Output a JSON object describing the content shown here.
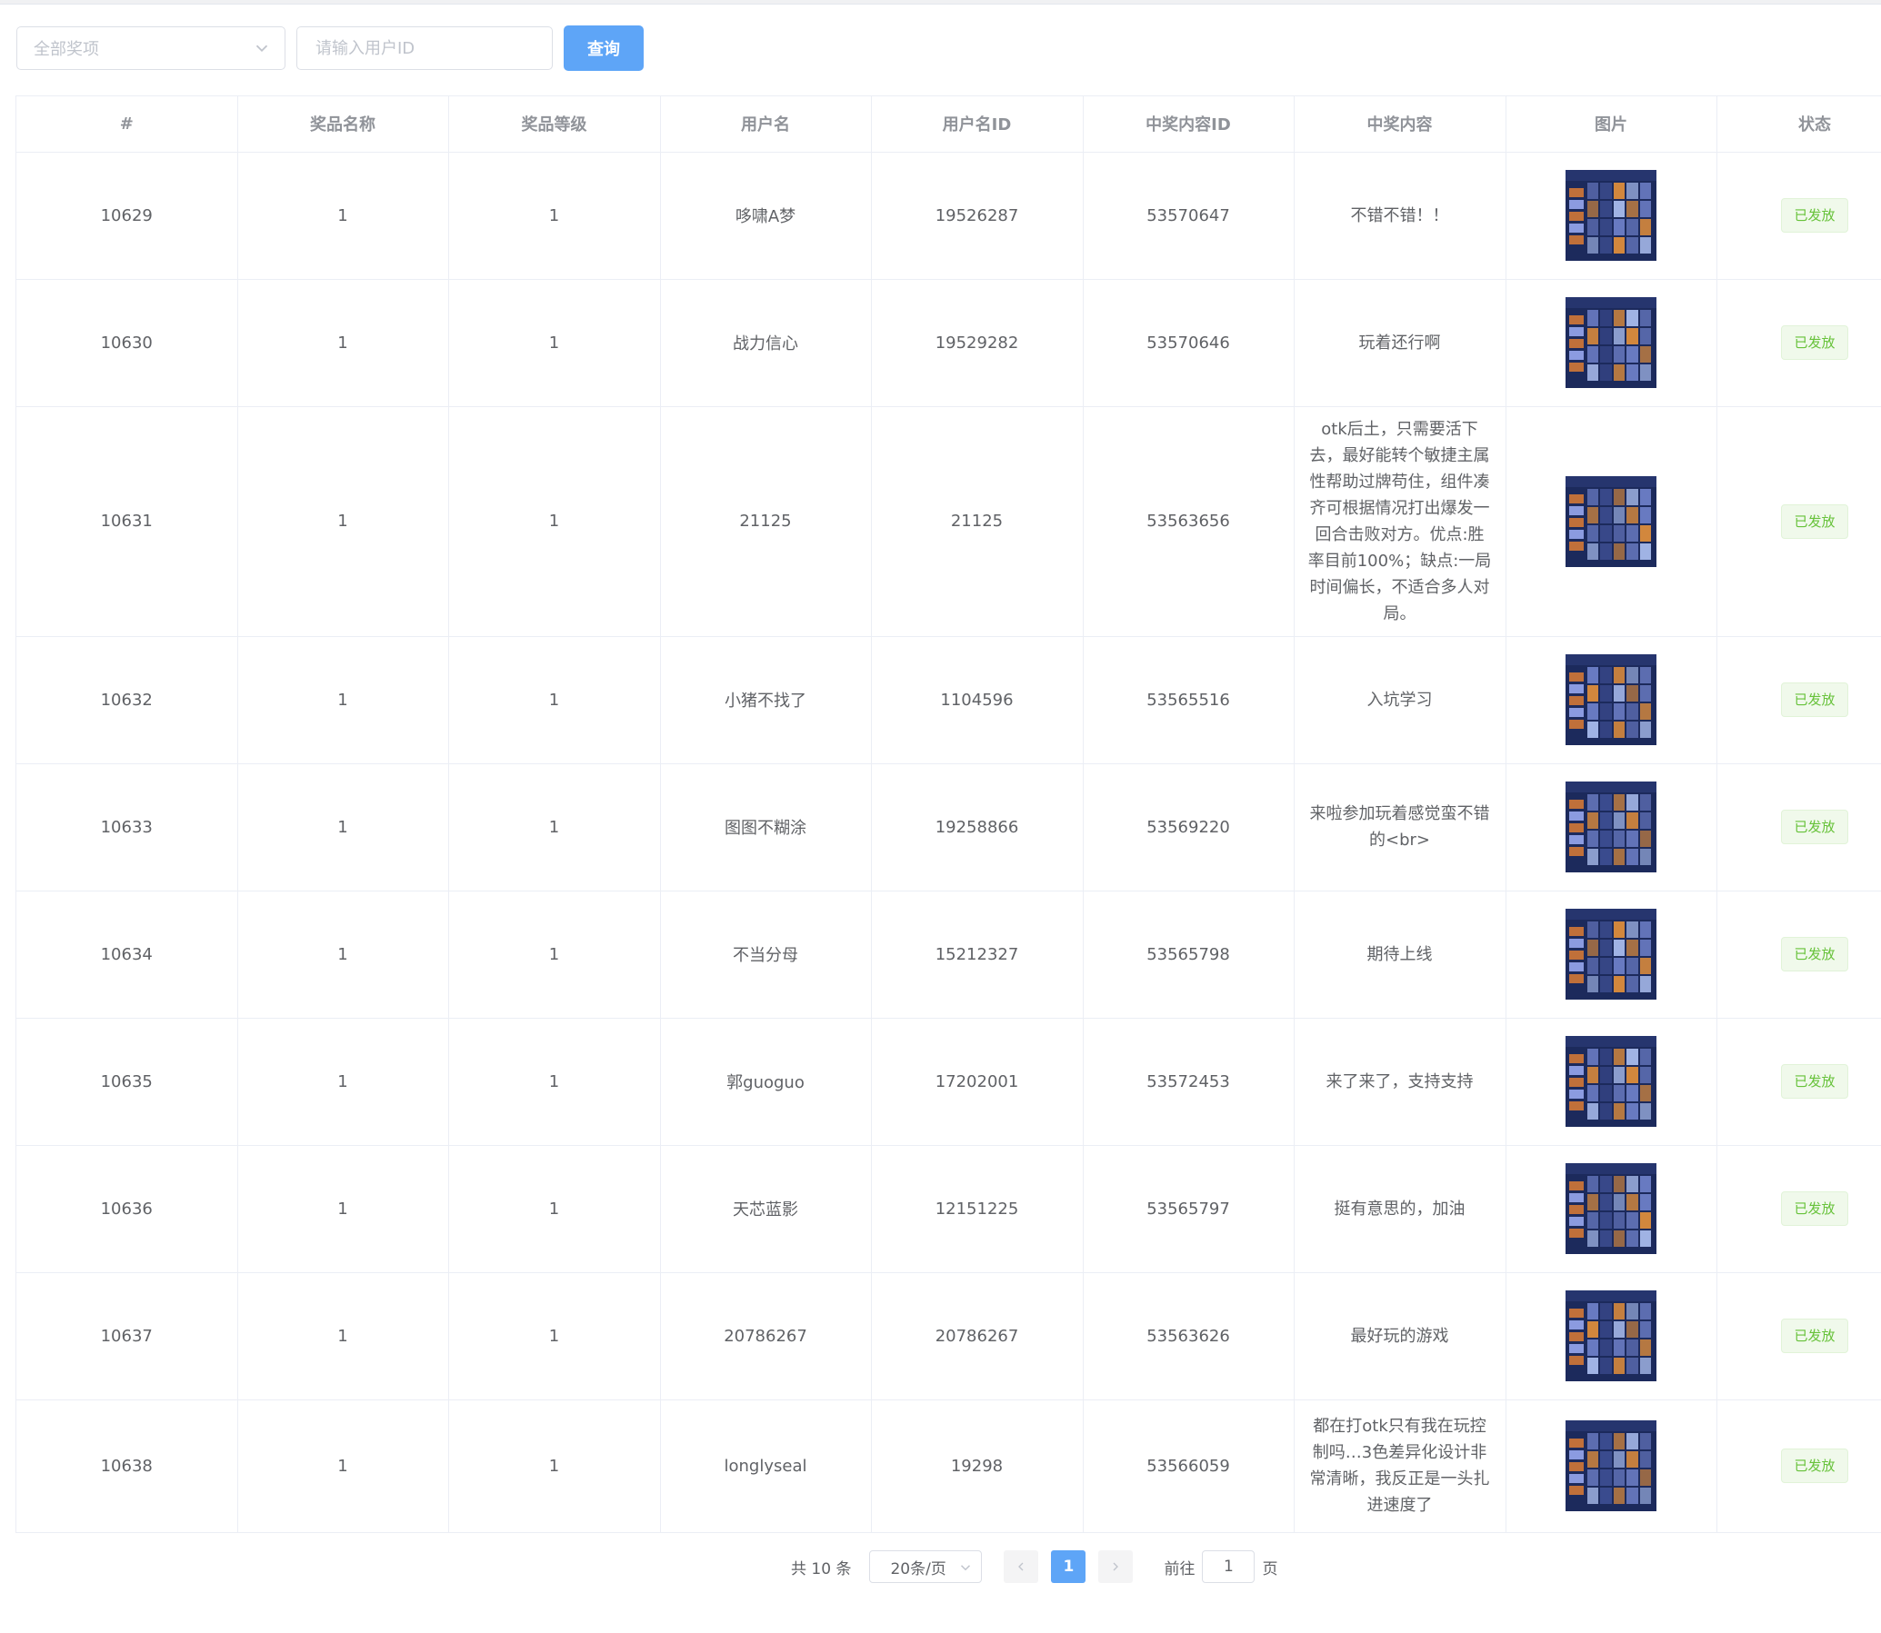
{
  "filters": {
    "prize_select_placeholder": "全部奖项",
    "user_id_placeholder": "请输入用户ID",
    "query_button": "查询"
  },
  "table": {
    "columns": [
      "#",
      "奖品名称",
      "奖品等级",
      "用户名",
      "用户名ID",
      "中奖内容ID",
      "中奖内容",
      "图片",
      "状态"
    ],
    "rows": [
      {
        "id": "10629",
        "prize_name": "1",
        "prize_level": "1",
        "username": "哆啸A梦",
        "user_id": "19526287",
        "content_id": "53570647",
        "content": "不错不错！！",
        "status": "已发放"
      },
      {
        "id": "10630",
        "prize_name": "1",
        "prize_level": "1",
        "username": "战力信心",
        "user_id": "19529282",
        "content_id": "53570646",
        "content": "玩着还行啊",
        "status": "已发放"
      },
      {
        "id": "10631",
        "prize_name": "1",
        "prize_level": "1",
        "username": "21125",
        "user_id": "21125",
        "content_id": "53563656",
        "content": "otk后土，只需要活下去，最好能转个敏捷主属性帮助过牌苟住，组件凑齐可根据情况打出爆发一回合击败对方。优点:胜率目前100%；缺点:一局时间偏长，不适合多人对局。",
        "status": "已发放"
      },
      {
        "id": "10632",
        "prize_name": "1",
        "prize_level": "1",
        "username": "小猪不找了",
        "user_id": "1104596",
        "content_id": "53565516",
        "content": "入坑学习",
        "status": "已发放"
      },
      {
        "id": "10633",
        "prize_name": "1",
        "prize_level": "1",
        "username": "图图不糊涂",
        "user_id": "19258866",
        "content_id": "53569220",
        "content": "来啦参加玩着感觉蛮不错的<br>",
        "status": "已发放"
      },
      {
        "id": "10634",
        "prize_name": "1",
        "prize_level": "1",
        "username": "不当分母",
        "user_id": "15212327",
        "content_id": "53565798",
        "content": "期待上线",
        "status": "已发放"
      },
      {
        "id": "10635",
        "prize_name": "1",
        "prize_level": "1",
        "username": "郭guoguo",
        "user_id": "17202001",
        "content_id": "53572453",
        "content": "来了来了，支持支持",
        "status": "已发放"
      },
      {
        "id": "10636",
        "prize_name": "1",
        "prize_level": "1",
        "username": "天芯蓝影",
        "user_id": "12151225",
        "content_id": "53565797",
        "content": "挺有意思的，加油",
        "status": "已发放"
      },
      {
        "id": "10637",
        "prize_name": "1",
        "prize_level": "1",
        "username": "20786267",
        "user_id": "20786267",
        "content_id": "53563626",
        "content": "最好玩的游戏",
        "status": "已发放"
      },
      {
        "id": "10638",
        "prize_name": "1",
        "prize_level": "1",
        "username": "longlyseal",
        "user_id": "19298",
        "content_id": "53566059",
        "content": "都在打otk只有我在玩控制吗…3色差异化设计非常清晰，我反正是一头扎进速度了",
        "status": "已发放"
      }
    ]
  },
  "pagination": {
    "total": "共 10 条",
    "page_size": "20条/页",
    "current_page": "1",
    "goto_label": "前往",
    "goto_value": "1",
    "page_suffix": "页"
  },
  "colors": {
    "primary": "#5ea5f7",
    "success_text": "#67c23a",
    "success_bg": "#f0f9eb"
  }
}
